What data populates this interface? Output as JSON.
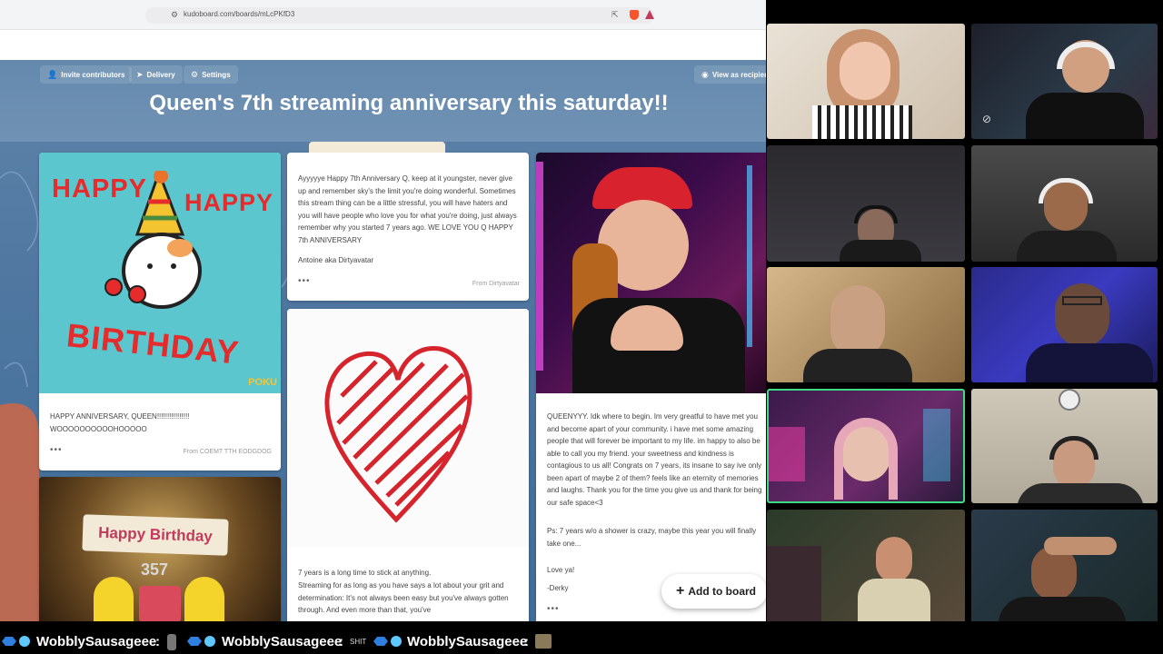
{
  "browser": {
    "url": "kudoboard.com/boards/mLcPKfD3"
  },
  "toolbar": {
    "invite_label": "Invite contributors",
    "delivery_label": "Delivery",
    "settings_label": "Settings",
    "view_label": "View as recipien"
  },
  "board": {
    "title": "Queen's 7th streaming anniversary this saturday!!",
    "add_button_label": "Add to board"
  },
  "cards": {
    "birthday_gif": {
      "line1": "HAPPY",
      "line2": "HAPPY",
      "line3": "BIRTHDAY",
      "watermark": "POKU",
      "message": "HAPPY ANNIVERSARY, QUEEN!!!!!!!!!!!!!!!! WOOOOOOOOOOHOOOOO",
      "from": "From COEMT TTH EODGDOG"
    },
    "dirtyavatar": {
      "message": "Ayyyyye Happy 7th Anniversary Q, keep at it youngster, never give up and remember sky's the limit you're doing wonderful. Sometimes this stream thing can be a little stressful, you will have haters and you will have people who love you for what you're doing, just always remember why you started 7 years ago. WE LOVE YOU Q HAPPY 7th ANNIVERSARY",
      "signature": "Antoine aka Dirtyavatar",
      "from": "From Dirtyavatar"
    },
    "heart": {
      "message_line1": "7 years is a long time to stick at anything.",
      "message_rest": "Streaming for as long as you have says a lot about your grit and determination: It's not always been easy but you've always gotten through. And even more than that, you've"
    },
    "derky": {
      "message": "QUEENYYY. Idk where to begin. Im very greatful to have met you and become apart of your community. i have met some amazing people that will forever be important to my life. im happy to also be able to call you my friend. your sweetness and kindness is contagious to us all! Congrats on 7 years, its insane to say ive only been apart of maybe 2 of them? feels like an eternity of memories and laughs. Thank you for the time you give us and thank for being our safe space<3",
      "ps": "Ps: 7 years w/o a shower is crazy, maybe this year you will finally take one...",
      "closing": "Love ya!",
      "signature": "-Derky"
    },
    "minion": {
      "banner": "Happy Birthday",
      "cake_number": "357"
    }
  },
  "chat": {
    "entries": [
      {
        "user": "WobblySausageee",
        "sep": ":"
      },
      {
        "user": "WobblySausageee",
        "sep": ":",
        "emote_text": "SHIT"
      },
      {
        "user": "WobblySausageee",
        "sep": ":"
      }
    ]
  },
  "colors": {
    "board_bg": "#4f77a0",
    "card_teal": "#5cc6cf",
    "heart_red": "#d6242c",
    "active_speaker": "#3ddc84"
  }
}
